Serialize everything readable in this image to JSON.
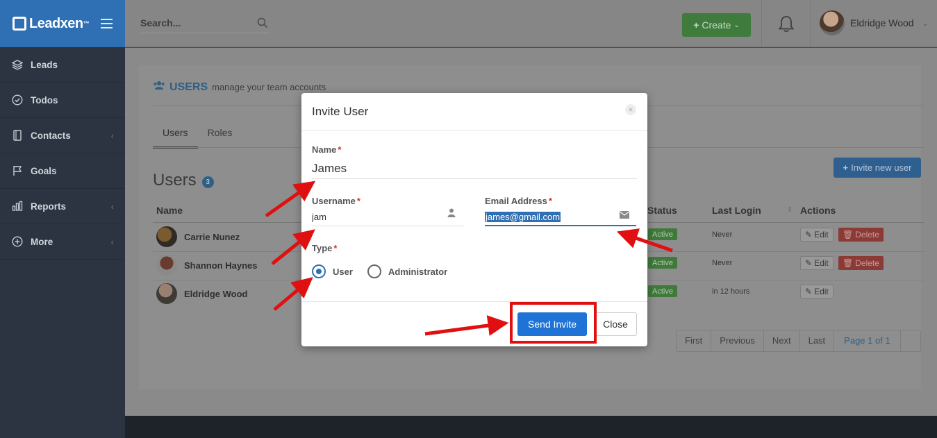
{
  "app": {
    "name": "Leadxen",
    "trademark": "™"
  },
  "sidebar": {
    "items": [
      {
        "label": "Leads",
        "icon": "layers-icon"
      },
      {
        "label": "Todos",
        "icon": "check-circle-icon"
      },
      {
        "label": "Contacts",
        "icon": "address-book-icon",
        "has_caret": true
      },
      {
        "label": "Goals",
        "icon": "flag-icon"
      },
      {
        "label": "Reports",
        "icon": "bar-chart-icon",
        "has_caret": true
      },
      {
        "label": "More",
        "icon": "plus-circle-icon",
        "has_caret": true
      }
    ]
  },
  "topbar": {
    "search_placeholder": "Search...",
    "create_label": "Create",
    "user_name": "Eldridge Wood"
  },
  "page": {
    "heading": "USERS",
    "heading_sub": "manage your team accounts",
    "tabs": [
      {
        "label": "Users",
        "active": true
      },
      {
        "label": "Roles",
        "active": false
      }
    ],
    "users_title": "Users",
    "users_count": "3",
    "invite_label": "Invite new user",
    "columns": [
      "Name",
      "Status",
      "Last Login",
      "Actions"
    ],
    "rows": [
      {
        "name": "Carrie Nunez",
        "status": "Active",
        "last_login": "Never",
        "edit": "Edit",
        "delete": "Delete"
      },
      {
        "name": "Shannon Haynes",
        "status": "Active",
        "last_login": "Never",
        "edit": "Edit",
        "delete": "Delete"
      },
      {
        "name": "Eldridge Wood",
        "status": "Active",
        "last_login": "in 12 hours",
        "edit": "Edit"
      }
    ],
    "pager": [
      "First",
      "Previous",
      "Next",
      "Last",
      "Page 1 of 1",
      ""
    ]
  },
  "modal": {
    "title": "Invite User",
    "close_icon": "×",
    "name_label": "Name",
    "name_value": "James",
    "username_label": "Username",
    "username_value": "jam",
    "email_label": "Email Address",
    "email_value": "james@gmail.com",
    "type_label": "Type",
    "type_options": [
      {
        "label": "User",
        "checked": true
      },
      {
        "label": "Administrator",
        "checked": false
      }
    ],
    "required_mark": "*",
    "send_label": "Send Invite",
    "close_label": "Close"
  },
  "colors": {
    "brand": "#2f6fb3",
    "sidebar": "#2b3440",
    "primary_button": "#1f72d6",
    "annotation": "#e01010",
    "required": "#d0362b"
  }
}
